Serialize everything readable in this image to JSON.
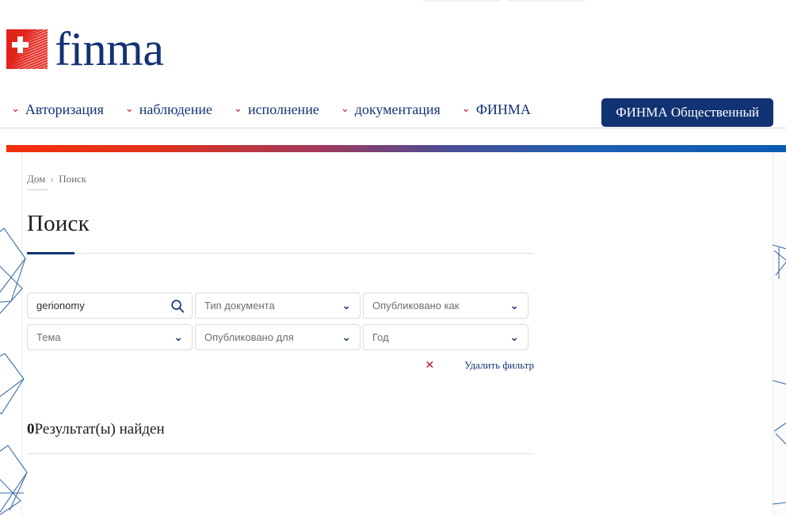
{
  "brand": {
    "logo_text": "finma",
    "logo_icon": "swiss-cross-flag-icon"
  },
  "nav": {
    "items": [
      {
        "label": "Авторизация",
        "icon": "chevron-down-icon"
      },
      {
        "label": "наблюдение",
        "icon": "chevron-down-icon"
      },
      {
        "label": "исполнение",
        "icon": "chevron-down-icon"
      },
      {
        "label": "документация",
        "icon": "chevron-down-icon"
      },
      {
        "label": "ФИНМА",
        "icon": "chevron-down-icon"
      }
    ],
    "cta_label": "ФИНМА Общественный"
  },
  "breadcrumb": {
    "home": "Дом",
    "separator": "›",
    "current": "Поиск"
  },
  "page": {
    "title": "Поиск"
  },
  "search": {
    "value": "gerionomy",
    "icon": "search-icon"
  },
  "filters": [
    {
      "placeholder": "Тип документа",
      "name": "document-type",
      "icon": "chevron-down-icon"
    },
    {
      "placeholder": "Опубликовано как",
      "name": "published-as",
      "icon": "chevron-down-icon"
    },
    {
      "placeholder": "Тема",
      "name": "topic",
      "icon": "chevron-down-icon"
    },
    {
      "placeholder": "Опубликовано для",
      "name": "published-for",
      "icon": "chevron-down-icon"
    },
    {
      "placeholder": "Год",
      "name": "year",
      "icon": "chevron-down-icon"
    }
  ],
  "filter_actions": {
    "clear_icon": "close-x-icon",
    "clear_label": "Удалить фильтр"
  },
  "results": {
    "count": "0",
    "label": "Результат(ы) найден"
  },
  "colors": {
    "brand_blue": "#123373",
    "brand_red": "#e2231a",
    "accent_red": "#c8102e",
    "gradient_start": "#f42f0c",
    "gradient_end": "#0b5cb5",
    "deco_line": "#3a6ea8"
  }
}
